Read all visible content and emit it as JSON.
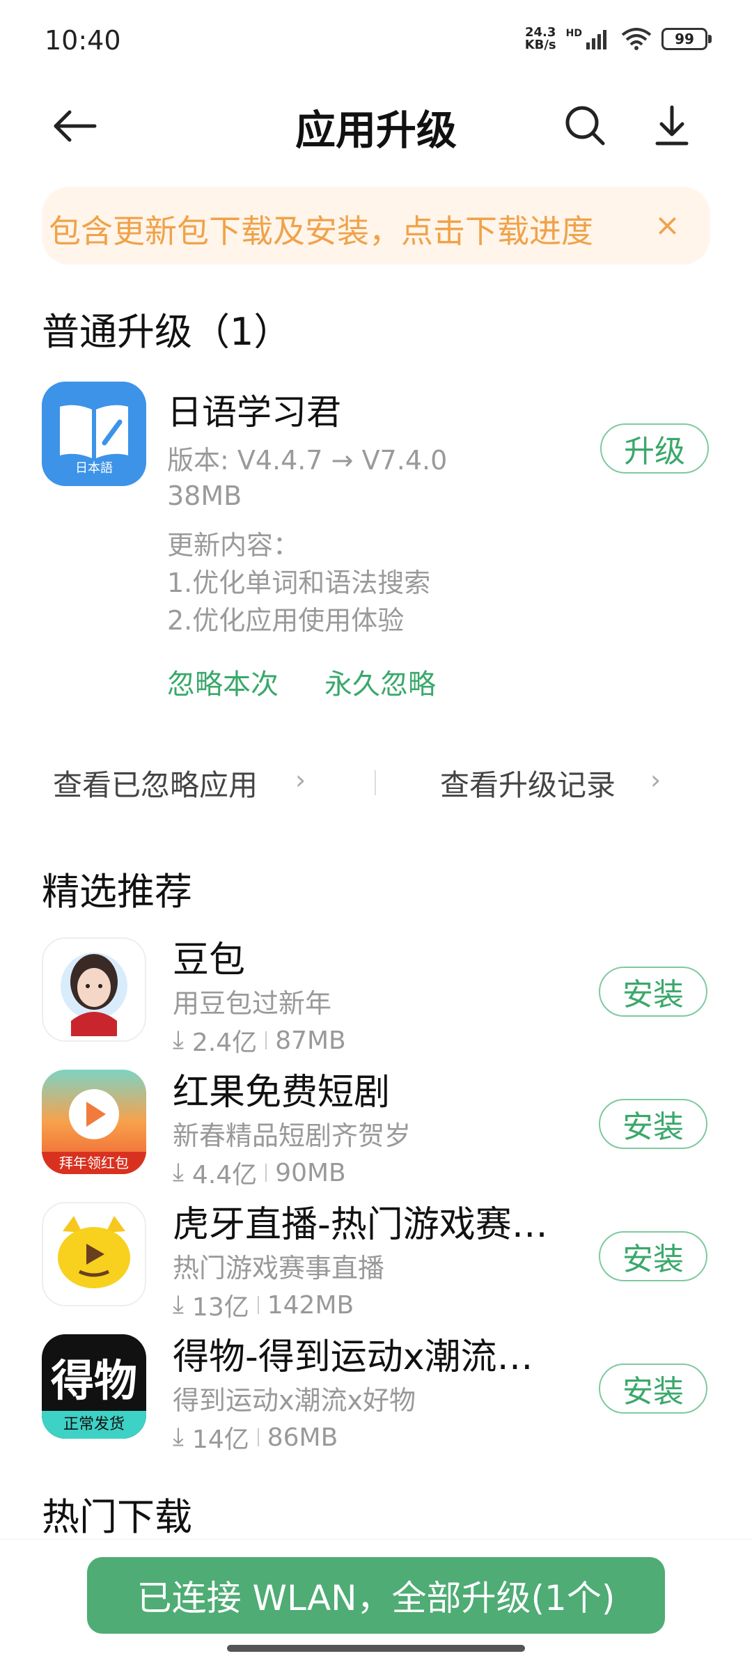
{
  "status": {
    "time": "10:40",
    "speed_value": "24.3",
    "speed_unit": "KB/s",
    "hd": "HD",
    "battery": "99"
  },
  "header": {
    "title": "应用升级"
  },
  "banner": {
    "text": "包含更新包下载及安装，点击下载进度",
    "close": "×"
  },
  "updates": {
    "section_title": "普通升级（1）",
    "item": {
      "name": "日语学习君",
      "version": "版本: V4.4.7 → V7.4.0",
      "size": "38MB",
      "changelog_title": "更新内容：",
      "changelog": [
        "1.优化单词和语法搜索",
        "2.优化应用使用体验"
      ],
      "button": "升级",
      "ignore_once": "忽略本次",
      "ignore_forever": "永久忽略",
      "icon_text": "日本語"
    }
  },
  "links": {
    "ignored": "查看已忽略应用",
    "history": "查看升级记录"
  },
  "recommend": {
    "section_title": "精选推荐",
    "items": [
      {
        "name": "豆包",
        "desc": "用豆包过新年",
        "downloads": "2.4亿",
        "size": "87MB",
        "button": "安装"
      },
      {
        "name": "红果免费短剧",
        "desc": "新春精品短剧齐贺岁",
        "downloads": "4.4亿",
        "size": "90MB",
        "button": "安装",
        "badge": "拜年领红包"
      },
      {
        "name": "虎牙直播-热门游戏赛…",
        "desc": "热门游戏赛事直播",
        "downloads": "13亿",
        "size": "142MB",
        "button": "安装"
      },
      {
        "name": "得物-得到运动x潮流…",
        "desc": "得到运动x潮流x好物",
        "downloads": "14亿",
        "size": "86MB",
        "button": "安装",
        "logo_text": "得物",
        "badge": "正常发货"
      }
    ]
  },
  "hot": {
    "section_title": "热门下载"
  },
  "bottom": {
    "button": "已连接 WLAN，全部升级(1个)"
  },
  "colors": {
    "accent": "#4eac74",
    "banner_bg": "#fff5ea",
    "banner_text": "#f0a24a"
  },
  "icons": [
    "back-arrow-icon",
    "search-icon",
    "download-icon",
    "close-icon",
    "download-count-icon",
    "chevron-right-icon"
  ]
}
